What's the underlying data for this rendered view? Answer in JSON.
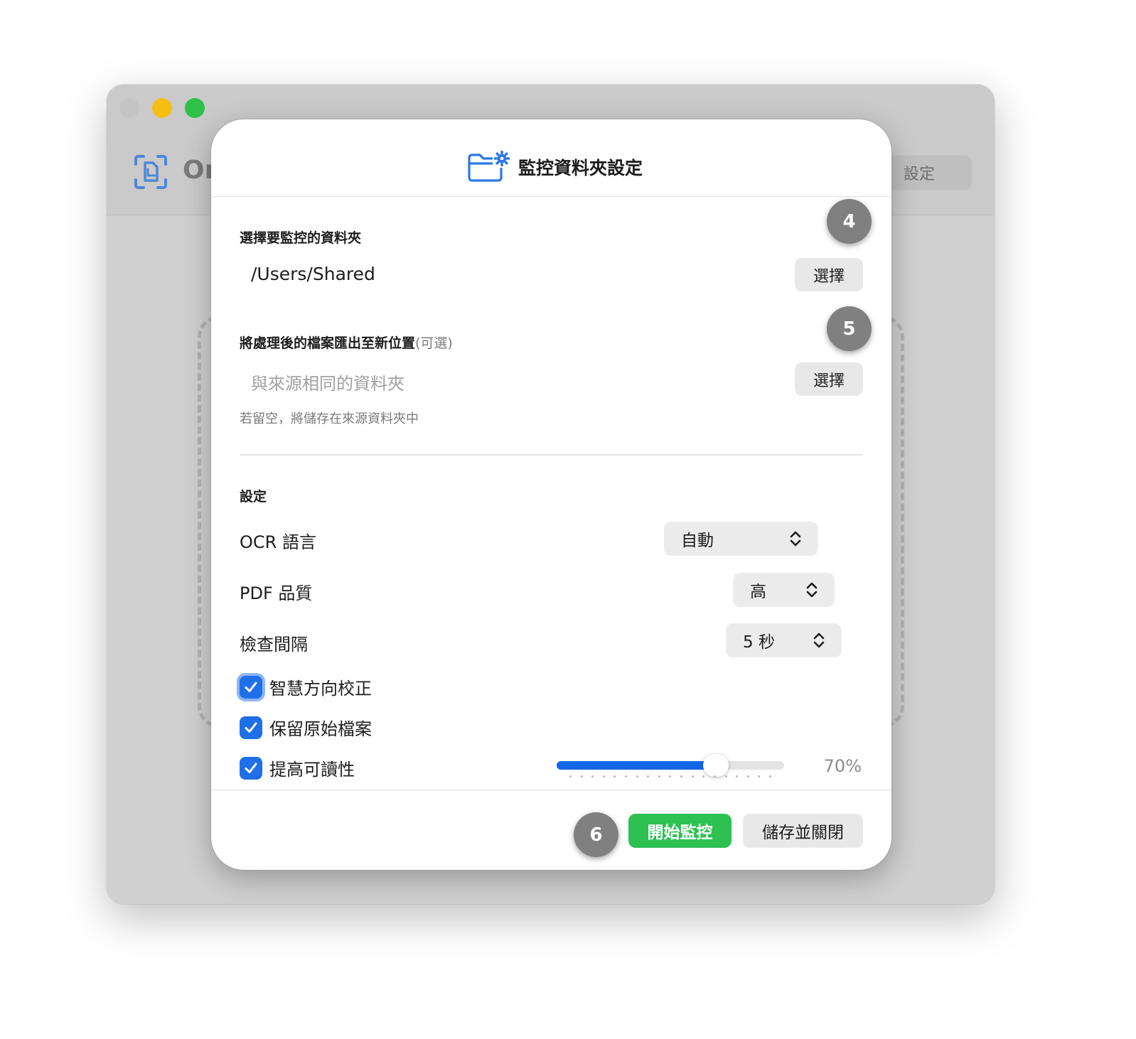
{
  "background_window": {
    "app_title": "Or",
    "settings_label": "設定"
  },
  "sheet": {
    "title": "監控資料夾設定",
    "source": {
      "label": "選擇要監控的資料夾",
      "path": "/Users/Shared",
      "choose_label": "選擇"
    },
    "export": {
      "label": "將處理後的檔案匯出至新位置",
      "optional": "(可選)",
      "placeholder": "與來源相同的資料夾",
      "choose_label": "選擇",
      "hint": "若留空，將儲存在來源資料夾中"
    },
    "settings": {
      "label": "設定",
      "ocr_language": {
        "label": "OCR 語言",
        "value": "自動"
      },
      "pdf_quality": {
        "label": "PDF 品質",
        "value": "高"
      },
      "check_interval": {
        "label": "檢查間隔",
        "value": "5 秒"
      },
      "smart_orientation": {
        "label": "智慧方向校正",
        "checked": true
      },
      "keep_original": {
        "label": "保留原始檔案",
        "checked": true
      },
      "enhance_readability": {
        "label": "提高可讀性",
        "checked": true,
        "level": 0.7,
        "value_text": "70%"
      }
    },
    "footer": {
      "start_label": "開始監控",
      "save_close_label": "儲存並關閉"
    }
  },
  "badges": {
    "b4": "4",
    "b5": "5",
    "b6": "6"
  },
  "colors": {
    "accent": "#1f6fe9",
    "start_button": "#2ec152",
    "badge": "#808080"
  }
}
